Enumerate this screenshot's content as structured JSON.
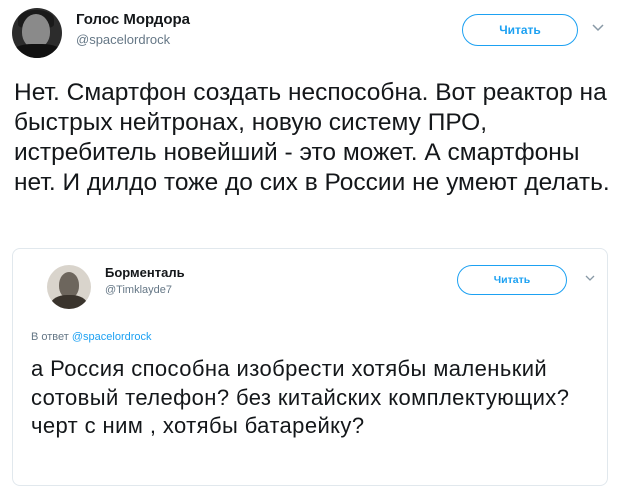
{
  "tweet": {
    "author": {
      "name": "Голос Мордора",
      "handle": "@spacelordrock"
    },
    "follow_label": "Читать",
    "more_icon": "chevron-down-icon",
    "text": "Нет. Смартфон создать неспособна. Вот реактор на быстрых нейтронах, новую систему ПРО, истребитель новейший - это может. А смартфоны нет. И дилдо тоже до сих в России не умеют делать."
  },
  "quoted_tweet": {
    "author": {
      "name": "Борменталь",
      "handle": "@Timklayde7"
    },
    "follow_label": "Читать",
    "more_icon": "chevron-down-icon",
    "reply_prefix": "В ответ",
    "reply_mention": "@spacelordrock",
    "text": "а Россия способна изобрести хотябы маленький сотовый телефон? без китайских комплектующих? черт с ним , хотябы батарейку?"
  },
  "colors": {
    "accent": "#1da1f2",
    "secondary_text": "#657786",
    "text": "#14171a"
  }
}
